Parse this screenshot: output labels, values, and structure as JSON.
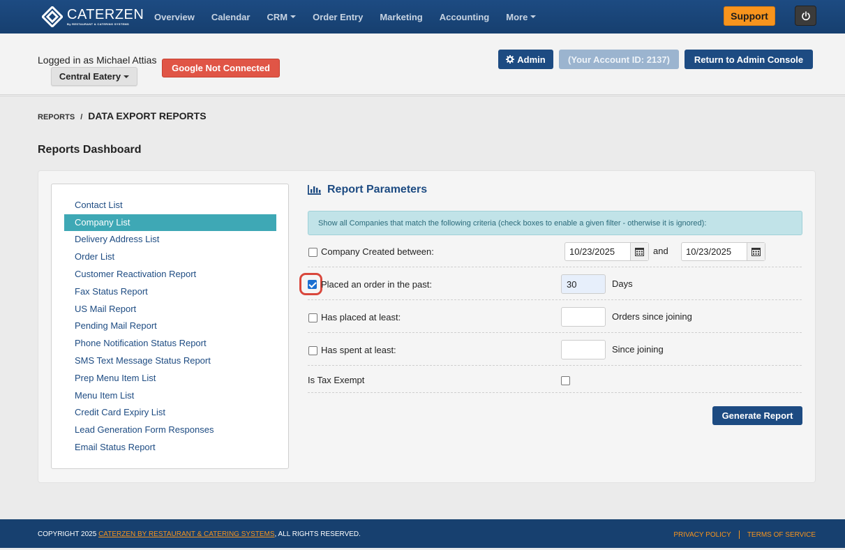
{
  "brand": {
    "name": "CATERZEN",
    "sub": "By RESTAURANT & CATERING SYSTEMS"
  },
  "nav": {
    "items": [
      {
        "label": "Overview",
        "dropdown": false
      },
      {
        "label": "Calendar",
        "dropdown": false
      },
      {
        "label": "CRM",
        "dropdown": true
      },
      {
        "label": "Order Entry",
        "dropdown": false
      },
      {
        "label": "Marketing",
        "dropdown": false
      },
      {
        "label": "Accounting",
        "dropdown": false
      },
      {
        "label": "More",
        "dropdown": true
      }
    ],
    "support_label": "Support"
  },
  "header": {
    "logged_in": "Logged in as Michael Attias",
    "eatery": "Central Eatery",
    "google": "Google Not Connected",
    "admin": "Admin",
    "account_id": "(Your Account ID: 2137)",
    "return": "Return to Admin Console"
  },
  "breadcrumb": {
    "parent": "REPORTS",
    "separator": "/",
    "current": "DATA EXPORT REPORTS"
  },
  "page_title": "Reports Dashboard",
  "sidebar": {
    "items": [
      {
        "label": "Contact List",
        "active": false
      },
      {
        "label": "Company List",
        "active": true
      },
      {
        "label": "Delivery Address List",
        "active": false
      },
      {
        "label": "Order List",
        "active": false
      },
      {
        "label": "Customer Reactivation Report",
        "active": false
      },
      {
        "label": "Fax Status Report",
        "active": false
      },
      {
        "label": "US Mail Report",
        "active": false
      },
      {
        "label": "Pending Mail Report",
        "active": false
      },
      {
        "label": "Phone Notification Status Report",
        "active": false
      },
      {
        "label": "SMS Text Message Status Report",
        "active": false
      },
      {
        "label": "Prep Menu Item List",
        "active": false
      },
      {
        "label": "Menu Item List",
        "active": false
      },
      {
        "label": "Credit Card Expiry List",
        "active": false
      },
      {
        "label": "Lead Generation Form Responses",
        "active": false
      },
      {
        "label": "Email Status Report",
        "active": false
      }
    ]
  },
  "params": {
    "title": "Report Parameters",
    "info": "Show all Companies that match the following criteria (check boxes to enable a given filter - otherwise it is ignored):",
    "created": {
      "label": "Company Created between:",
      "checked": false,
      "from": "10/23/2025",
      "and": "and",
      "to": "10/23/2025"
    },
    "placed_past": {
      "label": "Placed an order in the past:",
      "checked": true,
      "value": "30",
      "unit": "Days"
    },
    "placed_least": {
      "label": "Has placed at least:",
      "checked": false,
      "value": "",
      "unit": "Orders since joining"
    },
    "spent_least": {
      "label": "Has spent at least:",
      "checked": false,
      "value": "",
      "unit": "Since joining"
    },
    "tax_exempt": {
      "label": "Is Tax Exempt",
      "checked": false
    },
    "generate": "Generate Report"
  },
  "footer": {
    "copyright_prefix": "COPYRIGHT 2025 ",
    "company_link": "CATERZEN BY RESTAURANT & CATERING SYSTEMS",
    "copyright_suffix": ", ALL RIGHTS RESERVED.",
    "privacy": "PRIVACY POLICY",
    "terms": "TERMS OF SERVICE"
  },
  "colors": {
    "nav_bg": "#1d4b82",
    "support": "#f7941d",
    "active_item": "#3ea8b5",
    "danger": "#e05546",
    "checkbox_checked": "#1a6fd1",
    "highlight": "#d9473c"
  },
  "icons": {
    "logo": "caterzen-diamond-icon",
    "power": "power-icon",
    "admin": "gear-icon",
    "report": "bar-chart-icon",
    "date": "calendar-icon"
  }
}
